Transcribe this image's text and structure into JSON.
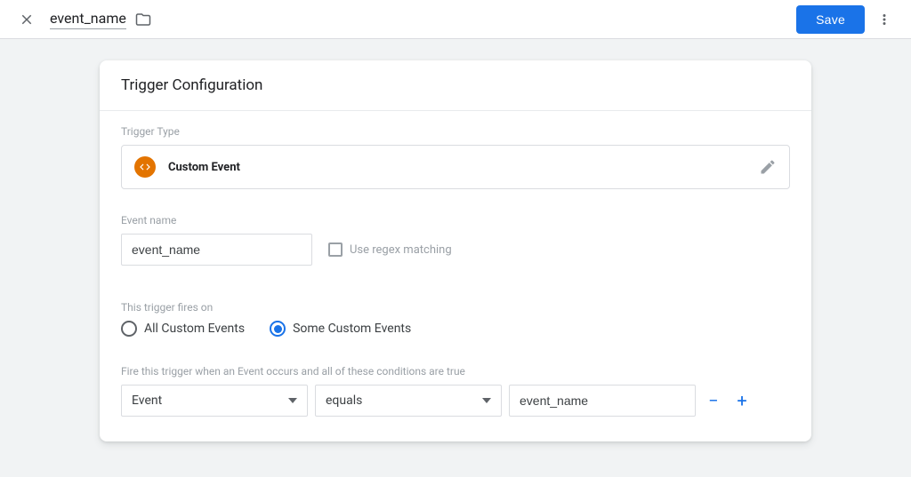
{
  "header": {
    "title": "event_name",
    "save_label": "Save"
  },
  "card": {
    "title": "Trigger Configuration",
    "trigger_type_label": "Trigger Type",
    "trigger_type_value": "Custom Event",
    "event_name_label": "Event name",
    "event_name_value": "event_name",
    "regex_label": "Use regex matching",
    "fires_on_label": "This trigger fires on",
    "fires_on_options": {
      "all": "All Custom Events",
      "some": "Some Custom Events"
    },
    "conditions_label": "Fire this trigger when an Event occurs and all of these conditions are true",
    "condition": {
      "variable": "Event",
      "operator": "equals",
      "value": "event_name"
    }
  }
}
